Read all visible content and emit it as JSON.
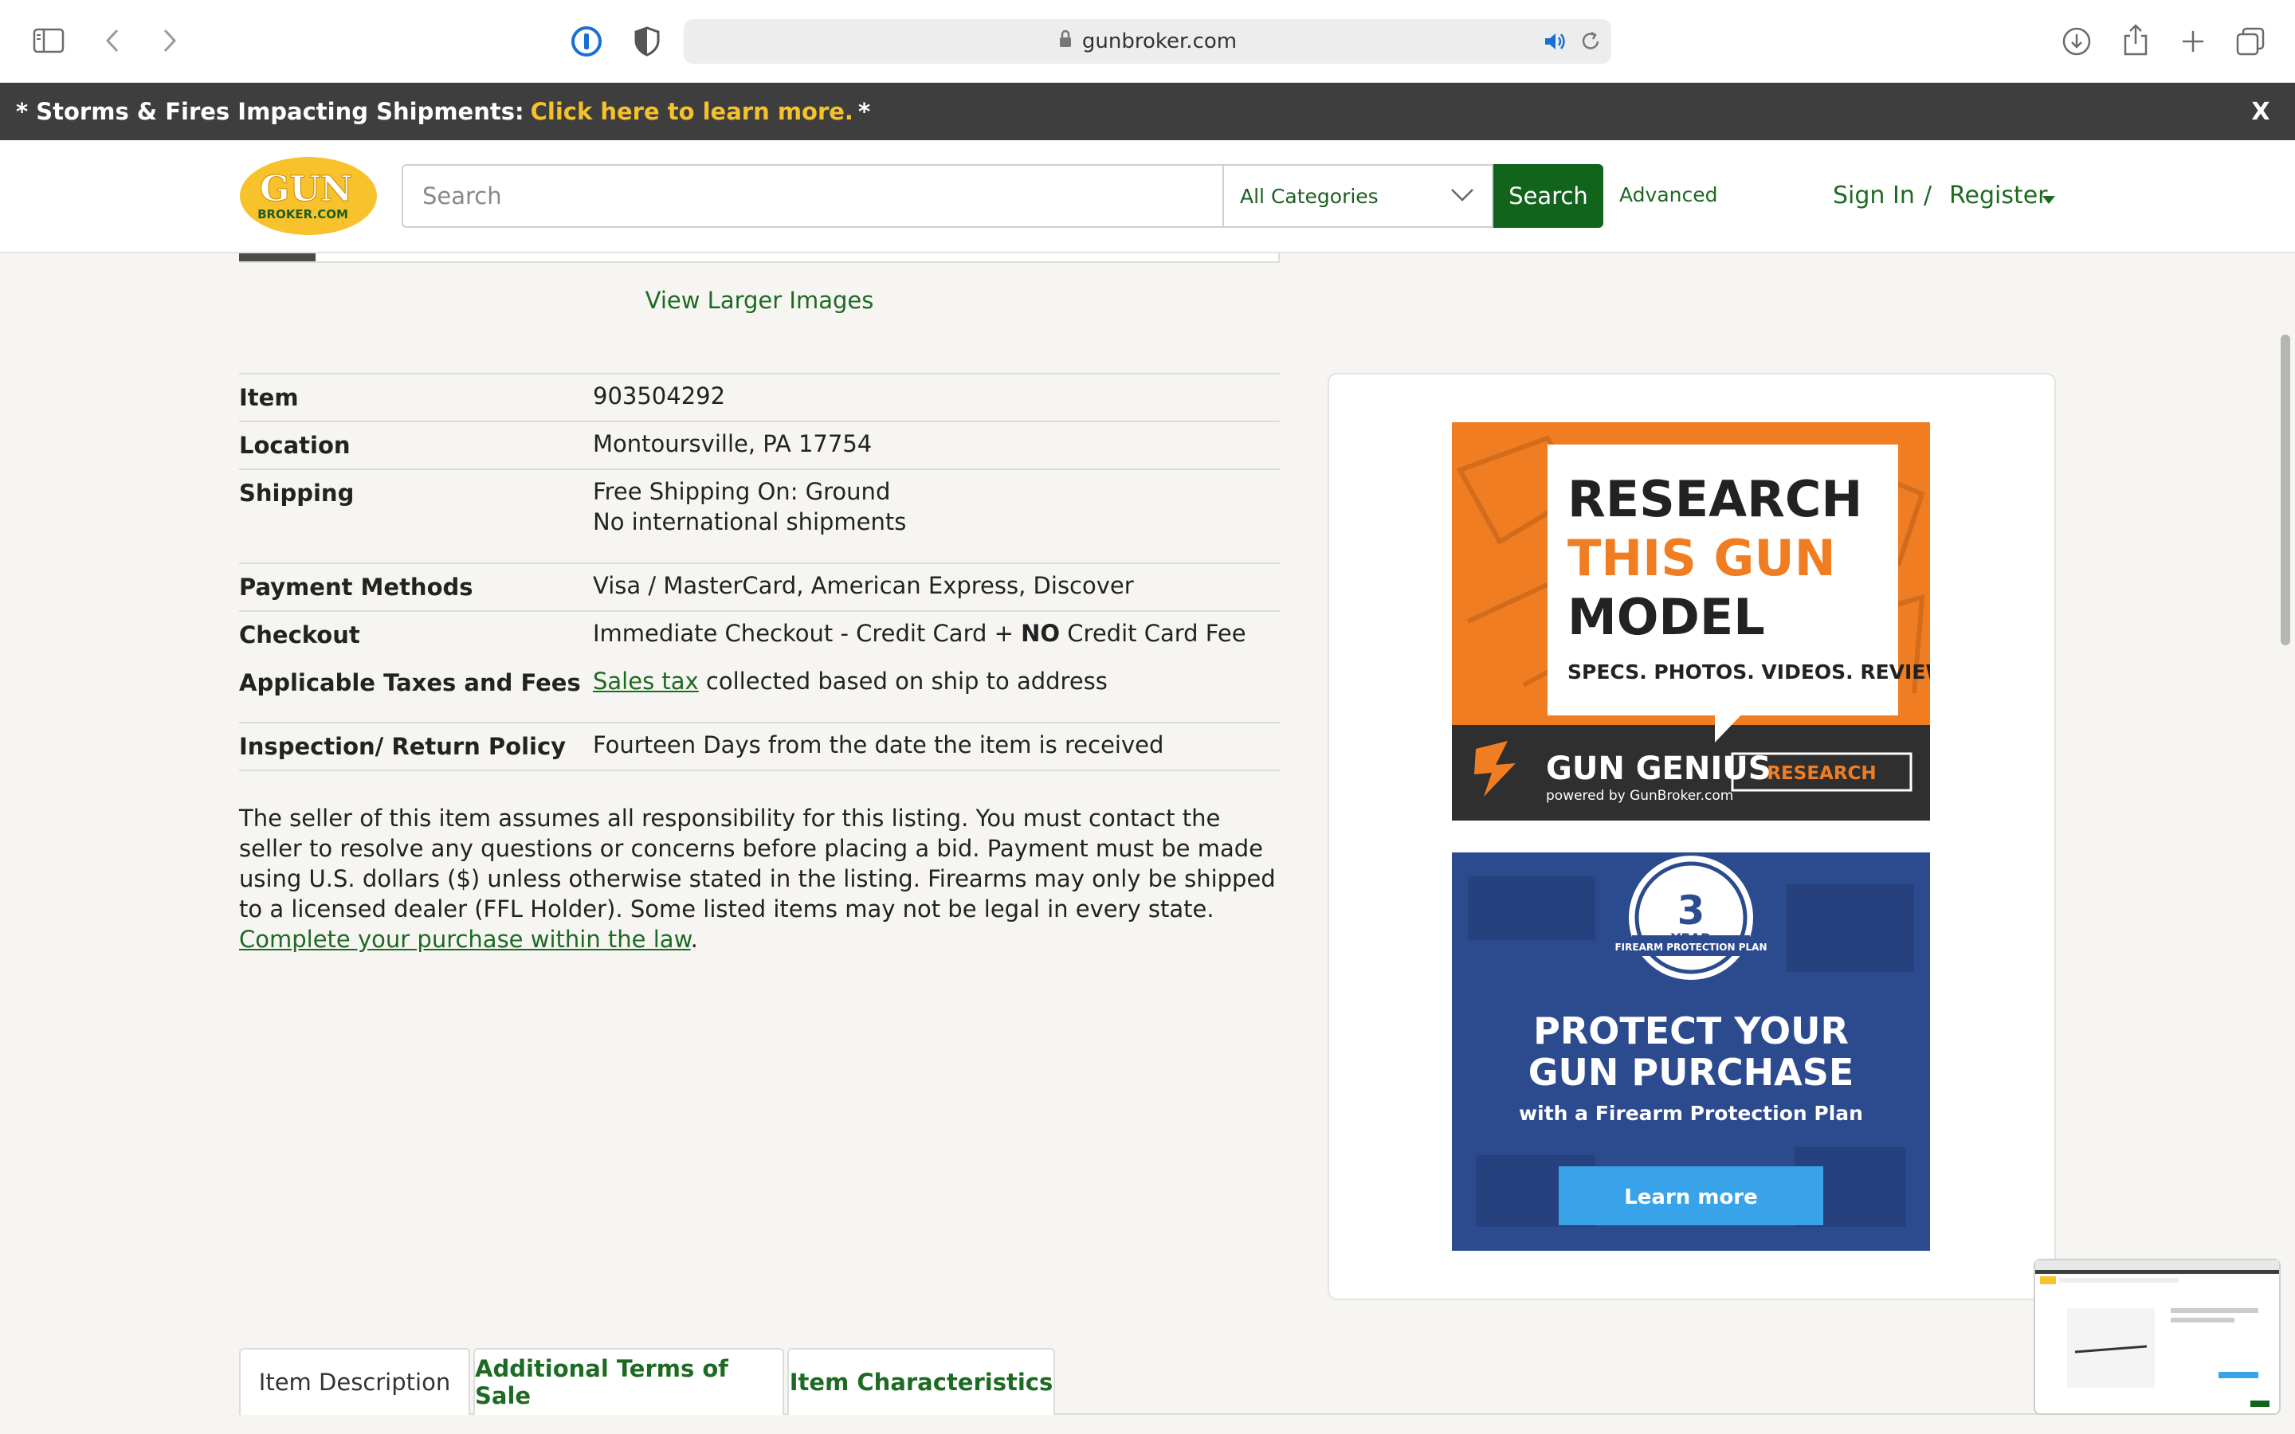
{
  "browser": {
    "url": "gunbroker.com"
  },
  "banner": {
    "prefix": "* Storms & Fires Impacting Shipments:",
    "link": "Click here to learn more.",
    "suffix": "*",
    "close": "X"
  },
  "header": {
    "logo_top": "GUN",
    "logo_bottom": "BROKER.COM",
    "search_placeholder": "Search",
    "category": "All Categories",
    "search_button": "Search",
    "advanced": "Advanced",
    "sign_in": "Sign In",
    "separator": "/",
    "register": "Register"
  },
  "gallery": {
    "view_larger": "View Larger Images"
  },
  "details": {
    "item_label": "Item",
    "item_value": "903504292",
    "location_label": "Location",
    "location_value": "Montoursville, PA 17754",
    "shipping_label": "Shipping",
    "shipping_line1": "Free Shipping On: Ground",
    "shipping_line2": "No international shipments",
    "payment_label": "Payment Methods",
    "payment_value": "Visa / MasterCard, American Express, Discover",
    "checkout_label": "Checkout",
    "checkout_pre": "Immediate Checkout - Credit Card + ",
    "checkout_bold": "NO",
    "checkout_post": " Credit Card Fee",
    "taxes_label": "Applicable Taxes and Fees",
    "taxes_link": "Sales tax",
    "taxes_rest": " collected based on ship to address",
    "return_label": "Inspection/ Return Policy",
    "return_value": "Fourteen Days from the date the item is received"
  },
  "disclaimer": {
    "text": "The seller of this item assumes all responsibility for this listing. You must contact the seller to resolve any questions or concerns before placing a bid. Payment must be made using U.S. dollars ($) unless otherwise stated in the listing. Firearms may only be shipped to a licensed dealer (FFL Holder). Some listed items may not be legal in every state. ",
    "link": "Complete your purchase within the law",
    "end": "."
  },
  "ads": {
    "ad1_line1": "RESEARCH",
    "ad1_line2": "THIS GUN",
    "ad1_line3": "MODEL",
    "ad1_tagline": "SPECS. PHOTOS. VIDEOS. REVIEWS.",
    "ad1_brand": "GUN GENIUS",
    "ad1_powered": "powered by GunBroker.com",
    "ad1_button": "RESEARCH",
    "ad2_badge_num": "3",
    "ad2_badge_year": "YEAR",
    "ad2_badge_plan": "FIREARM PROTECTION PLAN",
    "ad2_line1": "PROTECT YOUR",
    "ad2_line2": "GUN PURCHASE",
    "ad2_sub": "with a Firearm Protection Plan",
    "ad2_button": "Learn more"
  },
  "tabs": [
    {
      "label": "Item Description"
    },
    {
      "label": "Additional Terms of Sale"
    },
    {
      "label": "Item Characteristics"
    }
  ],
  "colors": {
    "brand_green": "#12641c",
    "link_green": "#1d6a22",
    "banner_bg": "#3e3e3e",
    "banner_link": "#f5c12d",
    "ad1_orange": "#f07d22",
    "ad2_blue": "#2c4a8e"
  }
}
